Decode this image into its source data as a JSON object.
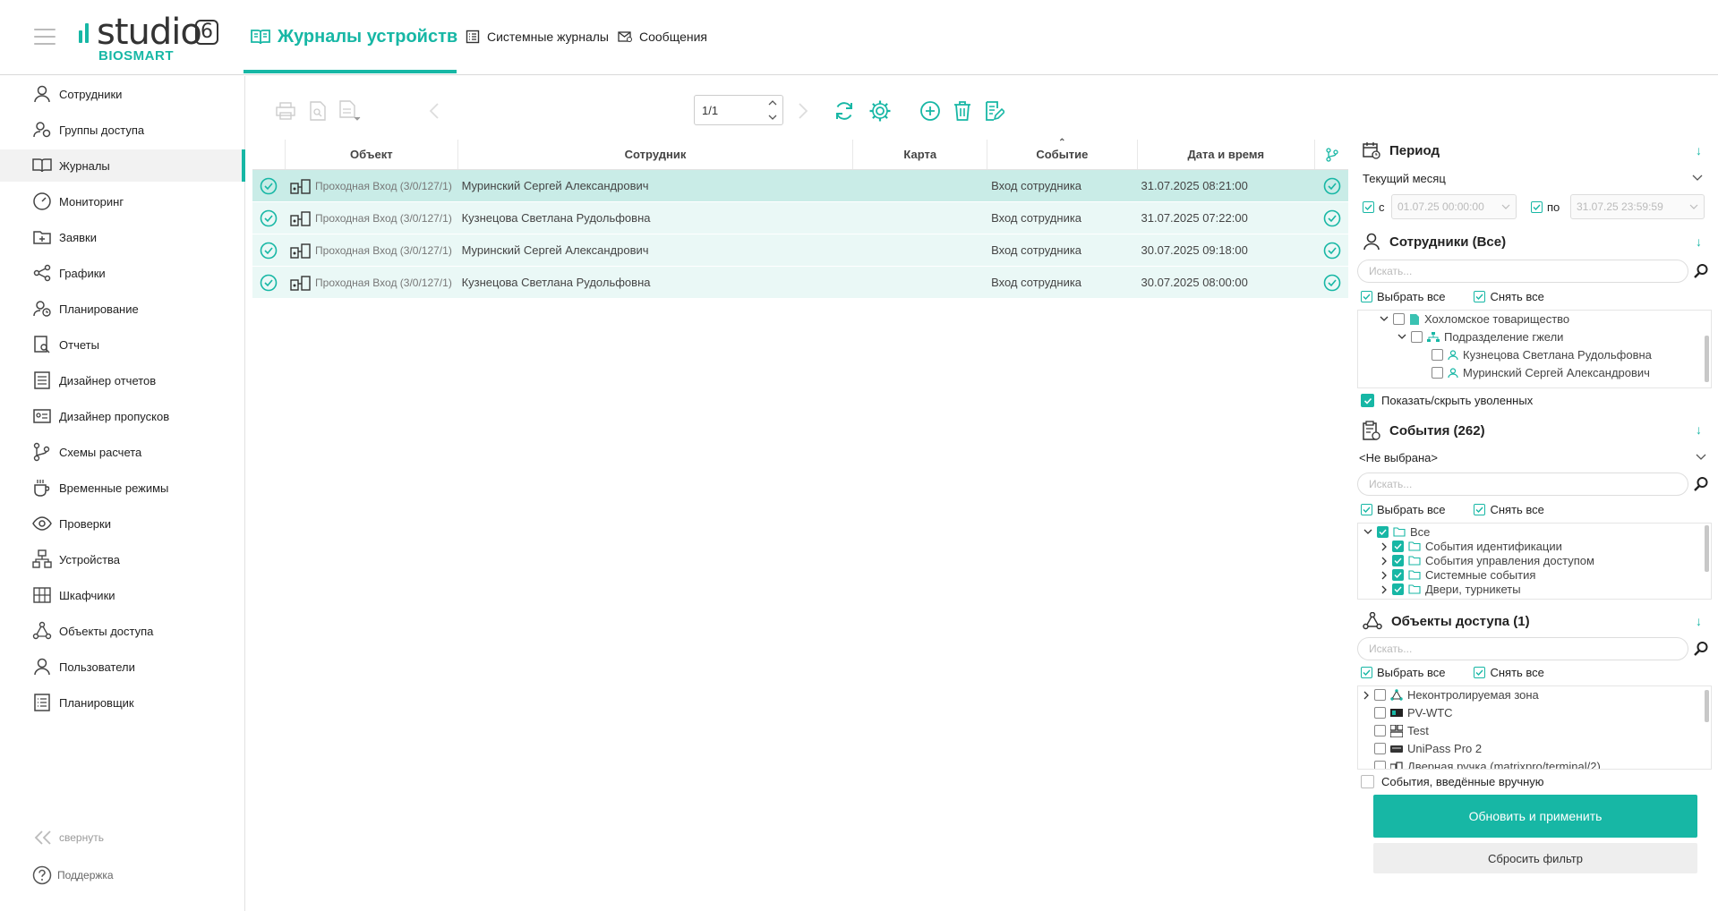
{
  "app": {
    "logo_text": "studio",
    "logo_version": "6",
    "logo_brand": "BIOSMART"
  },
  "tabs": {
    "device_logs": "Журналы устройств",
    "system_logs": "Системные журналы",
    "messages": "Сообщения"
  },
  "sidebar": {
    "items": [
      {
        "label": "Сотрудники",
        "icon": "user-icon"
      },
      {
        "label": "Группы доступа",
        "icon": "user-group-icon"
      },
      {
        "label": "Журналы",
        "icon": "book-icon"
      },
      {
        "label": "Мониторинг",
        "icon": "gauge-icon"
      },
      {
        "label": "Заявки",
        "icon": "folder-plus-icon"
      },
      {
        "label": "Графики",
        "icon": "share-icon"
      },
      {
        "label": "Планирование",
        "icon": "user-clock-icon"
      },
      {
        "label": "Отчеты",
        "icon": "report-search-icon"
      },
      {
        "label": "Дизайнер отчетов",
        "icon": "report-designer-icon"
      },
      {
        "label": "Дизайнер пропусков",
        "icon": "id-card-icon"
      },
      {
        "label": "Схемы расчета",
        "icon": "branch-icon"
      },
      {
        "label": "Временные режимы",
        "icon": "cup-icon"
      },
      {
        "label": "Проверки",
        "icon": "eye-icon"
      },
      {
        "label": "Устройства",
        "icon": "devices-icon"
      },
      {
        "label": "Шкафчики",
        "icon": "lockers-icon"
      },
      {
        "label": "Объекты доступа",
        "icon": "network-icon"
      },
      {
        "label": "Пользователи",
        "icon": "user-icon"
      },
      {
        "label": "Планировщик",
        "icon": "list-icon"
      }
    ],
    "collapse_label": "свернуть",
    "support_label": "Поддержка"
  },
  "toolbar": {
    "page_value": "1/1"
  },
  "table": {
    "columns": {
      "object": "Объект",
      "employee": "Сотрудник",
      "card": "Карта",
      "event": "Событие",
      "datetime": "Дата и время"
    },
    "rows": [
      {
        "object": "Проходная Вход (3/0/127/1)",
        "employee": "Муринский Сергей Александрович",
        "card": "",
        "event": "Вход сотрудника",
        "datetime": "31.07.2025 08:21:00"
      },
      {
        "object": "Проходная Вход (3/0/127/1)",
        "employee": "Кузнецова Светлана Рудольфовна",
        "card": "",
        "event": "Вход сотрудника",
        "datetime": "31.07.2025 07:22:00"
      },
      {
        "object": "Проходная Вход (3/0/127/1)",
        "employee": "Муринский Сергей Александрович",
        "card": "",
        "event": "Вход сотрудника",
        "datetime": "30.07.2025 09:18:00"
      },
      {
        "object": "Проходная Вход (3/0/127/1)",
        "employee": "Кузнецова Светлана Рудольфовна",
        "card": "",
        "event": "Вход сотрудника",
        "datetime": "30.07.2025 08:00:00"
      }
    ]
  },
  "filters": {
    "period": {
      "title": "Период",
      "selected": "Текущий месяц",
      "from_label": "с",
      "from_value": "01.07.25 00:00:00",
      "to_label": "по",
      "to_value": "31.07.25 23:59:59"
    },
    "employees": {
      "title": "Сотрудники (Все)",
      "search_placeholder": "Искать...",
      "select_all": "Выбрать все",
      "clear_all": "Снять все",
      "tree": [
        "Хохломское товарищество",
        "Подразделение гжели",
        "Кузнецова Светлана Рудольфовна",
        "Муринский Сергей Александрович"
      ],
      "show_fired": "Показать/скрыть уволенных"
    },
    "events": {
      "title": "События (262)",
      "selected": "<Не выбрана>",
      "search_placeholder": "Искать...",
      "select_all": "Выбрать все",
      "clear_all": "Снять все",
      "tree": [
        "Все",
        "События идентификации",
        "События управления доступом",
        "Системные события",
        "Двери, турникеты"
      ]
    },
    "access_objects": {
      "title": "Объекты доступа (1)",
      "search_placeholder": "Искать...",
      "select_all": "Выбрать все",
      "clear_all": "Снять все",
      "tree": [
        "Неконтролируемая зона",
        "PV-WTC",
        "Test",
        "UniPass Pro 2",
        "Дверная ручка (matrixpro/terminal/2)"
      ]
    },
    "manual_events": "События, введённые вручную",
    "apply_button": "Обновить и применить",
    "reset_button": "Сбросить фильтр"
  },
  "colors": {
    "accent": "#17b7a5",
    "row_bg": "#eaf8f6",
    "row_selected": "#c9ece7"
  }
}
